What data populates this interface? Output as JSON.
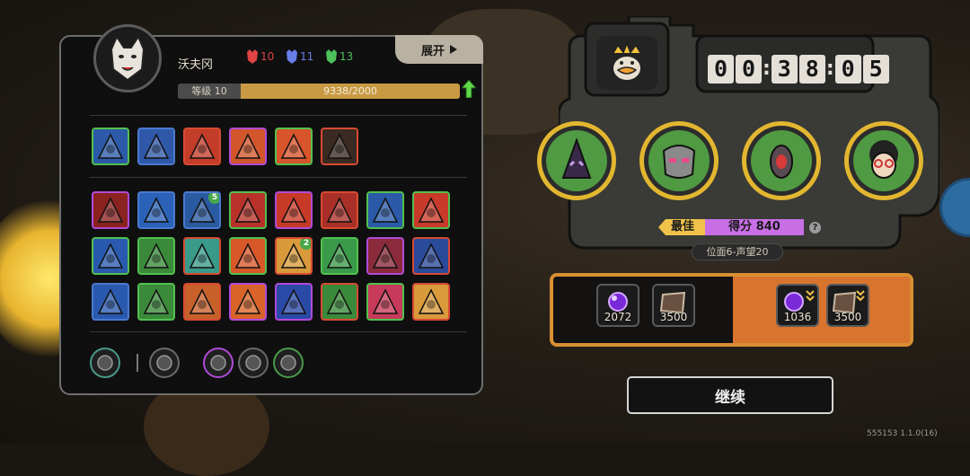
{
  "player": {
    "name": "沃夫冈",
    "level_label": "等级 10",
    "exp_value": "9338/2000",
    "exp_fill": 1.0
  },
  "resources": [
    {
      "icon": "red-mask-icon",
      "color": "#e04444",
      "value": "10"
    },
    {
      "icon": "blue-mask-icon",
      "color": "#6a7ee8",
      "value": "11"
    },
    {
      "icon": "green-mask-icon",
      "color": "#4cc05a",
      "value": "13"
    }
  ],
  "expand": {
    "label": "展开"
  },
  "skills_row1": [
    {
      "name": "ice-statue-skill",
      "border": "#52c04e",
      "bg": "#2c5aa8"
    },
    {
      "name": "spear-throw-skill",
      "border": "#4a7ad0",
      "bg": "#2f58a8"
    },
    {
      "name": "candle-fire-skill",
      "border": "#d84a32",
      "bg": "#c33d2a"
    },
    {
      "name": "flame-hand-skill",
      "border": "#b04ad8",
      "bg": "#d2562c"
    },
    {
      "name": "fire-spirit-skill",
      "border": "#52c04e",
      "bg": "#d8542a"
    },
    {
      "name": "green-heart-skill",
      "border": "#d84a32",
      "bg": "#3a2a22"
    }
  ],
  "skills_grid": [
    {
      "name": "red-claw-skill",
      "border": "#b04ad8",
      "bg": "#8a2220"
    },
    {
      "name": "lightning-orb-skill",
      "border": "#4a7ad0",
      "bg": "#2b62b8"
    },
    {
      "name": "blue-fish-skill",
      "border": "#4a7ad0",
      "bg": "#2a5aa0",
      "badge": "5"
    },
    {
      "name": "shadow-beast-skill",
      "border": "#52c04e",
      "bg": "#b8322a"
    },
    {
      "name": "golden-arrow-skill",
      "border": "#b04ad8",
      "bg": "#c83a28"
    },
    {
      "name": "axe-strike-skill",
      "border": "#d84a32",
      "bg": "#a83028"
    },
    {
      "name": "ice-slash-skill",
      "border": "#52c04e",
      "bg": "#2a5aa8"
    },
    {
      "name": "pointing-hand-skill",
      "border": "#52c04e",
      "bg": "#c83a2a"
    },
    {
      "name": "storm-ring-skill",
      "border": "#52c04e",
      "bg": "#2a5ab0"
    },
    {
      "name": "green-tome-skill",
      "border": "#52c04e",
      "bg": "#3a8a3a"
    },
    {
      "name": "crystal-shard-skill",
      "border": "#d84a32",
      "bg": "#3a9a8a"
    },
    {
      "name": "fire-burst-skill",
      "border": "#52c04e",
      "bg": "#d8582a"
    },
    {
      "name": "sunrise-skill",
      "border": "#d84a32",
      "bg": "#d89a3a",
      "badge": "2"
    },
    {
      "name": "nature-crown-skill",
      "border": "#52c04e",
      "bg": "#3a9a4a"
    },
    {
      "name": "demon-mask-skill",
      "border": "#b04ad8",
      "bg": "#8a2a3a"
    },
    {
      "name": "blue-gate-skill",
      "border": "#d84a32",
      "bg": "#2a4a9a"
    },
    {
      "name": "dash-runner-skill",
      "border": "#4a7ad0",
      "bg": "#2a5ab0"
    },
    {
      "name": "red-arrow-skill",
      "border": "#52c04e",
      "bg": "#3a8a3a"
    },
    {
      "name": "temple-skill",
      "border": "#d84a32",
      "bg": "#c8602a"
    },
    {
      "name": "sun-eye-skill",
      "border": "#b04ad8",
      "bg": "#d8642a"
    },
    {
      "name": "dark-orb-skill",
      "border": "#b04ad8",
      "bg": "#2a4aa8"
    },
    {
      "name": "green-wing-skill",
      "border": "#d84a32",
      "bg": "#3a8a3a"
    },
    {
      "name": "explosion-skill",
      "border": "#52c04e",
      "bg": "#c83a5a"
    },
    {
      "name": "lion-mask-skill",
      "border": "#d84a32",
      "bg": "#d89a3a"
    }
  ],
  "equipment": [
    {
      "name": "mouth-relic-icon",
      "border": "#4a9a8a"
    },
    {
      "name": "spider-relic-icon",
      "border": "#6a6a6a"
    },
    {
      "name": "green-orb-relic-icon",
      "border": "#b04ad8"
    },
    {
      "name": "gear-relic-icon",
      "border": "#6a6a6a"
    },
    {
      "name": "scroll-relic-icon",
      "border": "#4a9a4a"
    }
  ],
  "timer": {
    "d1": "0",
    "d2": "0",
    "d3": "3",
    "d4": "8",
    "d5": "0",
    "d6": "5",
    "sep": ":"
  },
  "heroes": [
    {
      "name": "dark-hooded-hero"
    },
    {
      "name": "masked-warrior-hero"
    },
    {
      "name": "red-robot-hero"
    },
    {
      "name": "glasses-kid-hero"
    }
  ],
  "score": {
    "best_label": "最佳",
    "score_label": "得分 840",
    "help": "?",
    "position": "位面6-声望20"
  },
  "rewards": {
    "left": [
      {
        "icon": "purple-orb-icon",
        "value": "2072"
      },
      {
        "icon": "brown-card-icon",
        "value": "3500"
      }
    ],
    "right": [
      {
        "icon": "purple-orb-icon",
        "value": "1036"
      },
      {
        "icon": "brown-card-icon",
        "value": "3500"
      }
    ]
  },
  "continue": {
    "label": "继续"
  },
  "version": "555153 1.1.0(16)"
}
